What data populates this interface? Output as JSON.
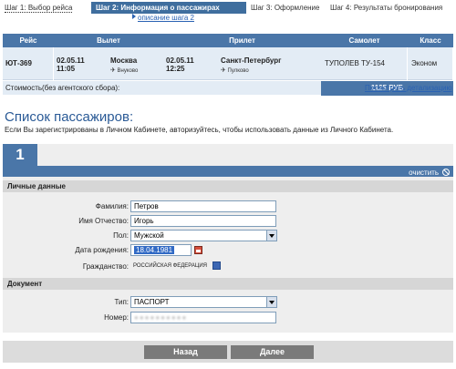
{
  "steps": {
    "step1": "Шаг 1: Выбор рейса",
    "step2": "Шаг 2: Информация о пассажирах",
    "step3": "Шаг 3: Оформление",
    "step4": "Шаг 4: Результаты бронирования",
    "desc_link": "описание шага 2"
  },
  "flight": {
    "headers": {
      "flight": "Рейс",
      "departure": "Вылет",
      "arrival": "Прилет",
      "plane": "Самолет",
      "class": "Класс"
    },
    "number": "ЮТ-369",
    "dep_date": "02.05.11",
    "dep_time": "11:05",
    "dep_city": "Москва",
    "dep_airport": "Внуково",
    "arr_date": "02.05.11",
    "arr_time": "12:25",
    "arr_city": "Санкт-Петербург",
    "arr_airport": "Пулково",
    "plane": "ТУПОЛЕВ ТУ-154",
    "class": "Эконом",
    "cost_label": "Стоимость(без агентского сбора):",
    "cost_value": "1125 РУБ",
    "detail_link": "Посмотреть детализацию"
  },
  "passengers": {
    "title": "Список пассажиров:",
    "info": "Если Вы зарегистрированы в Личном Кабинете, авторизуйтесь, чтобы использовать данные из Личного Кабинета.",
    "number": "1",
    "clear_label": "очистить",
    "personal_header": "Личные данные",
    "labels": {
      "surname": "Фамилия:",
      "name": "Имя Отчество:",
      "gender": "Пол:",
      "birthdate": "Дата рождения:",
      "citizenship": "Гражданство:"
    },
    "values": {
      "surname": "Петров",
      "name": "Игорь",
      "gender": "Мужской",
      "birthdate": "18.04.1981",
      "citizenship": "РОССИЙСКАЯ ФЕДЕРАЦИЯ"
    },
    "document_header": "Документ",
    "doc_labels": {
      "type": "Тип:",
      "number": "Номер:"
    },
    "doc_values": {
      "type": "ПАСПОРТ",
      "number": "●●●●●●●●●●"
    }
  },
  "nav": {
    "back": "Назад",
    "next": "Далее"
  },
  "colors": {
    "accent": "#4a76a8",
    "active_step": "#3f6e9e",
    "row_bg": "#e3ecf5",
    "button": "#7a7a7a"
  },
  "icons": [
    "clear-icon",
    "calendar-icon",
    "flag-icon",
    "plane-icon",
    "arrow-right-icon"
  ]
}
